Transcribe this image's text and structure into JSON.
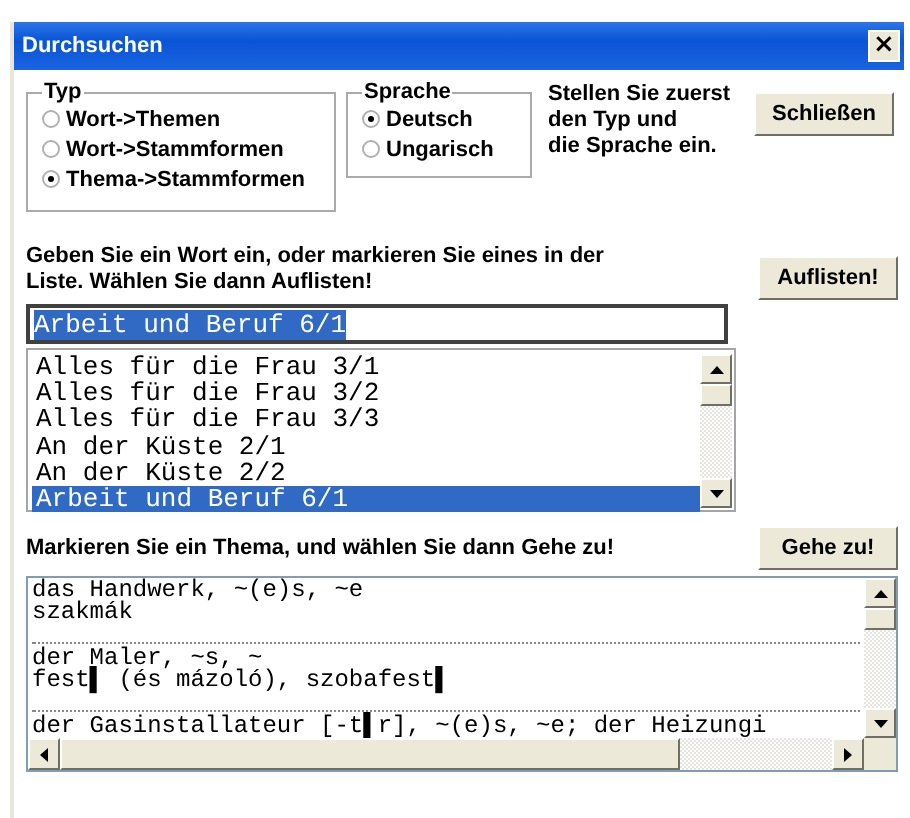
{
  "window": {
    "title": "Durchsuchen",
    "close": "×"
  },
  "type_group": {
    "label": "Typ",
    "options": [
      {
        "label": "Wort->Themen",
        "selected": false
      },
      {
        "label": "Wort->Stammformen",
        "selected": false
      },
      {
        "label": "Thema->Stammformen",
        "selected": true
      }
    ]
  },
  "language_group": {
    "label": "Sprache",
    "options": [
      {
        "label": "Deutsch",
        "selected": true
      },
      {
        "label": "Ungarisch",
        "selected": false
      }
    ]
  },
  "hint_lines": [
    "Stellen Sie zuerst",
    "den Typ und",
    "die Sprache ein."
  ],
  "close_button": "Schließen",
  "instruction": "Geben Sie ein Wort ein, oder markieren Sie eines in der Liste. Wählen Sie dann Auflisten!",
  "list_button": "Auflisten!",
  "search_field": {
    "value": "Arbeit und Beruf 6/1",
    "text_selected": true
  },
  "topics": [
    {
      "label": "Alles für die Frau 3/1",
      "selected": false
    },
    {
      "label": "Alles für die Frau 3/2",
      "selected": false
    },
    {
      "label": "Alles für die Frau 3/3",
      "selected": false
    },
    {
      "label": "An der Küste 2/1",
      "selected": false
    },
    {
      "label": "An der Küste 2/2",
      "selected": false
    },
    {
      "label": "Arbeit und Beruf 6/1",
      "selected": true
    }
  ],
  "goto_instruction": "Markieren Sie ein Thema, und wählen Sie dann Gehe zu!",
  "goto_button": "Gehe zu!",
  "entries": [
    {
      "lines": [
        "das Handwerk, ~(e)s, ~e",
        "szakmák"
      ]
    },
    {
      "lines": [
        "der Maler, ~s, ~",
        "fest▌ (és mázoló), szobafest▌"
      ]
    },
    {
      "lines": [
        "der Gasinstallateur [-t▌r], ~(e)s, ~e; der Heizungi"
      ]
    }
  ]
}
